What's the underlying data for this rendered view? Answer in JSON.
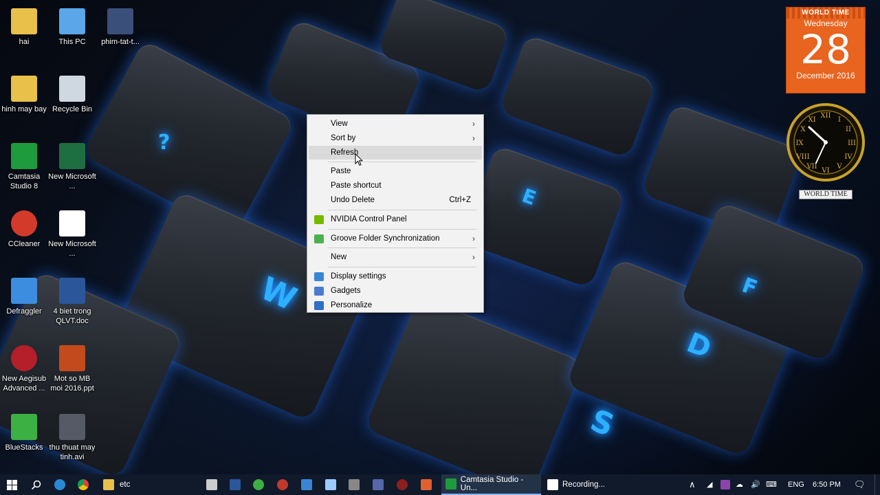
{
  "desktop_icons": [
    {
      "label": "hai",
      "icon": "folder-icon",
      "color": "#e8c04a"
    },
    {
      "label": "This PC",
      "icon": "computer-icon",
      "color": "#5aa6e8"
    },
    {
      "label": "phim-tat-t...",
      "icon": "image-file-icon",
      "color": "#3a4f7a"
    },
    {
      "label": "hinh may bay",
      "icon": "folder-icon",
      "color": "#e8c04a"
    },
    {
      "label": "Recycle Bin",
      "icon": "recycle-bin-icon",
      "color": "#cfd8e0"
    },
    {
      "label": "Camtasia Studio 8",
      "icon": "camtasia-icon",
      "color": "#1e9b3c"
    },
    {
      "label": "New Microsoft ...",
      "icon": "excel-file-icon",
      "color": "#1d6f42"
    },
    {
      "label": "CCleaner",
      "icon": "ccleaner-icon",
      "color": "#d43a2a"
    },
    {
      "label": "New Microsoft ...",
      "icon": "document-file-icon",
      "color": "#ffffff"
    },
    {
      "label": "Defraggler",
      "icon": "defraggler-icon",
      "color": "#3c8de0"
    },
    {
      "label": "4 biet trong QLVT.doc",
      "icon": "word-file-icon",
      "color": "#2b579a"
    },
    {
      "label": "New Aegisub Advanced ...",
      "icon": "aegisub-icon",
      "color": "#b51f2a"
    },
    {
      "label": "Mot so MB moi 2016.ppt",
      "icon": "powerpoint-file-icon",
      "color": "#c24a1c"
    },
    {
      "label": "BlueStacks",
      "icon": "bluestacks-icon",
      "color": "#3cb043"
    },
    {
      "label": "thu thuat may tinh.avi",
      "icon": "video-file-icon",
      "color": "#555a66"
    }
  ],
  "context_menu": {
    "items": [
      {
        "label": "View",
        "submenu": true
      },
      {
        "label": "Sort by",
        "submenu": true
      },
      {
        "label": "Refresh",
        "highlighted": true
      },
      {
        "separator": true
      },
      {
        "label": "Paste",
        "disabled": false
      },
      {
        "label": "Paste shortcut"
      },
      {
        "label": "Undo Delete",
        "shortcut": "Ctrl+Z"
      },
      {
        "separator": true
      },
      {
        "label": "NVIDIA Control Panel",
        "icon": "nvidia-icon",
        "icon_color": "#76b900"
      },
      {
        "separator": true
      },
      {
        "label": "Groove Folder Synchronization",
        "icon": "groove-icon",
        "icon_color": "#4caf50",
        "submenu": true
      },
      {
        "separator": true
      },
      {
        "label": "New",
        "submenu": true
      },
      {
        "separator": true
      },
      {
        "label": "Display settings",
        "icon": "display-icon",
        "icon_color": "#3a86d4"
      },
      {
        "label": "Gadgets",
        "icon": "gadgets-icon",
        "icon_color": "#4a7bd0"
      },
      {
        "label": "Personalize",
        "icon": "personalize-icon",
        "icon_color": "#2f6fc4"
      }
    ]
  },
  "world_time": {
    "header": "WORLD TIME",
    "weekday": "Wednesday",
    "day": "28",
    "month_year": "December 2016",
    "clock_label": "WORLD TIME"
  },
  "taskbar": {
    "pinned": [
      {
        "icon": "task-view-icon",
        "color": "#ffffff"
      },
      {
        "icon": "edge-icon",
        "color": "#2a8ad4"
      },
      {
        "icon": "chrome-icon",
        "color": "#e0b020"
      }
    ],
    "folder_task": "etc",
    "quick_icons": [
      {
        "icon": "store-icon",
        "color": "#cccccc"
      },
      {
        "icon": "word-icon",
        "color": "#2b579a"
      },
      {
        "icon": "app-green-icon",
        "color": "#3cb043"
      },
      {
        "icon": "app-red-icon",
        "color": "#c0392b"
      },
      {
        "icon": "app-blue-icon",
        "color": "#3a86d4"
      },
      {
        "icon": "notepad-icon",
        "color": "#9ecbff"
      },
      {
        "icon": "app-gray-icon",
        "color": "#888888"
      },
      {
        "icon": "app-dark-icon",
        "color": "#5566aa"
      },
      {
        "icon": "app-orange-icon",
        "color": "#e06030"
      }
    ],
    "tasks": [
      {
        "label": "Camtasia Studio - Un...",
        "icon": "camtasia-icon",
        "color": "#1e9b3c",
        "active": true
      },
      {
        "label": "Recording...",
        "icon": "recording-icon",
        "color": "#ffffff",
        "active": false
      }
    ],
    "tray": {
      "language": "ENG",
      "time": "6:50 PM"
    }
  }
}
